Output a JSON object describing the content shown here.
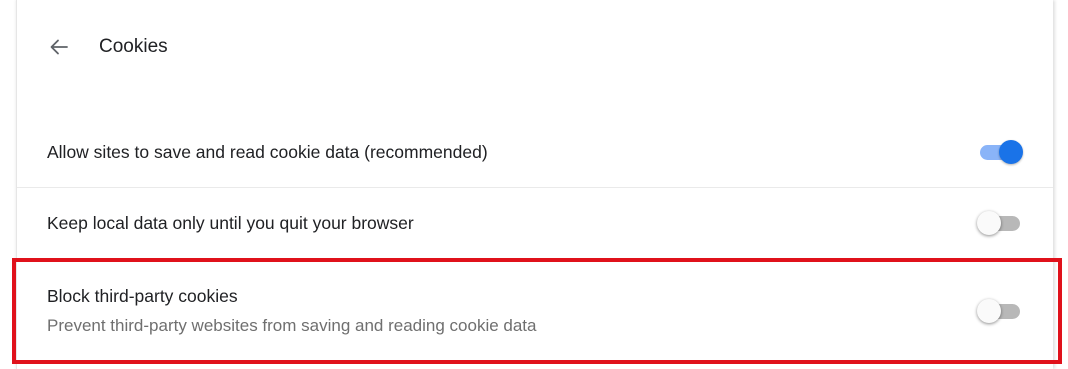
{
  "header": {
    "back_icon": "arrow-left-icon",
    "title": "Cookies"
  },
  "settings": [
    {
      "label": "Allow sites to save and read cookie data (recommended)",
      "enabled": true
    },
    {
      "label": "Keep local data only until you quit your browser",
      "enabled": false
    },
    {
      "label": "Block third-party cookies",
      "description": "Prevent third-party websites from saving and reading cookie data",
      "enabled": false
    }
  ],
  "colors": {
    "toggle_on_knob": "#1a73e8",
    "toggle_on_track": "#8ab4f8",
    "toggle_off_track": "#b8b8b8",
    "highlight_border": "#e0111b"
  }
}
